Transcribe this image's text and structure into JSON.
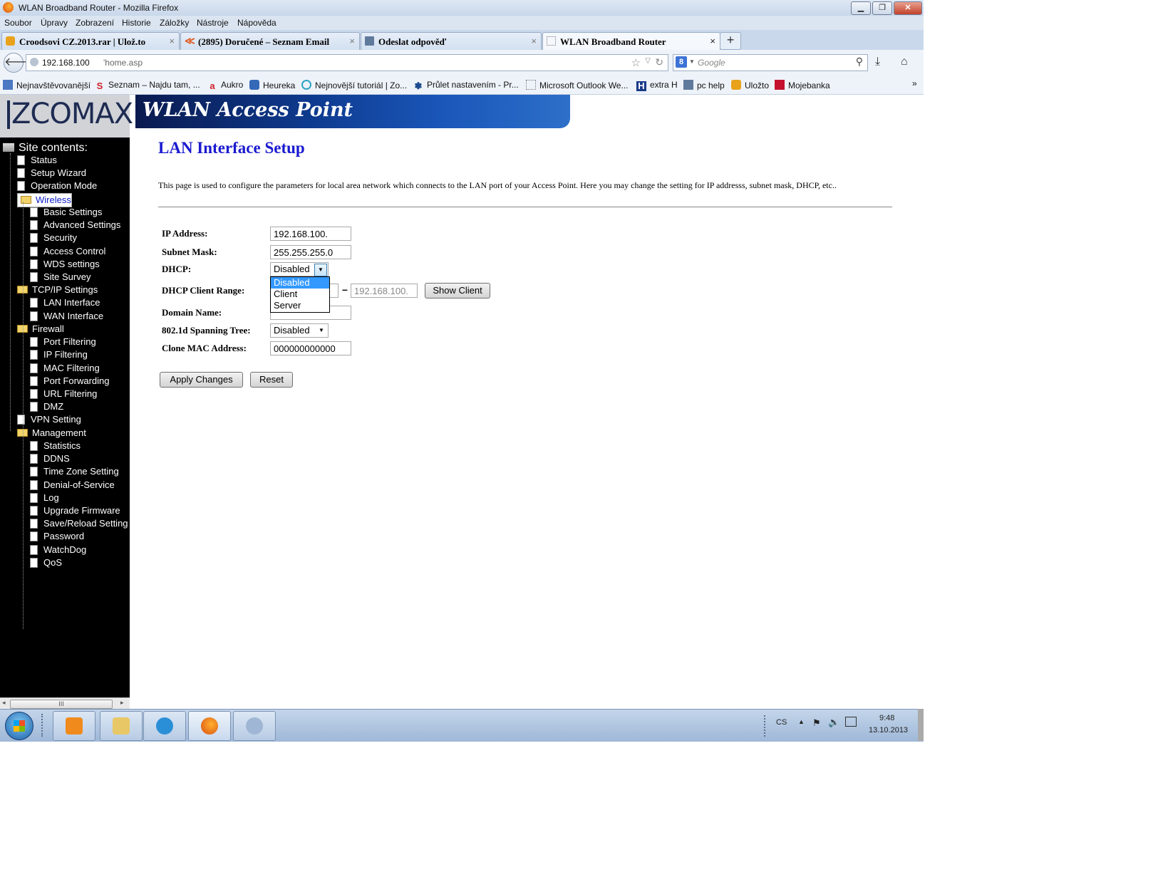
{
  "window": {
    "title": "WLAN Broadband Router - Mozilla Firefox",
    "buttons": {
      "minimize": "▁",
      "restore": "❐",
      "close": "✕"
    }
  },
  "menu": [
    "Soubor",
    "Úpravy",
    "Zobrazení",
    "Historie",
    "Záložky",
    "Nástroje",
    "Nápověda"
  ],
  "tabs": [
    {
      "label": "Croodsovi CZ.2013.rar | Ulož.to",
      "icon": "uloz-to-icon",
      "color": "#e9a21b"
    },
    {
      "label": "(2895) Doručené – Seznam Email",
      "icon": "seznam-email-icon",
      "color": "#e05a1e"
    },
    {
      "label": "Odeslat odpověď",
      "icon": "computer-icon",
      "color": "#607a9c"
    },
    {
      "label": "WLAN Broadband Router",
      "icon": "blank-page-icon",
      "color": "#ffffff"
    }
  ],
  "newtab_label": "+",
  "address": {
    "host": "192.168.100",
    "path": "'home.asp"
  },
  "search": {
    "engine": "8",
    "placeholder": "Google"
  },
  "bookmarks": [
    {
      "label": "Nejnavštěvovanější",
      "icon": "most-visited-icon",
      "glyph": "",
      "color": "#4a78c2"
    },
    {
      "label": "Seznam – Najdu tam, ...",
      "icon": "seznam-icon",
      "glyph": "S",
      "color": "#d0202a"
    },
    {
      "label": "Aukro",
      "icon": "aukro-icon",
      "glyph": "a",
      "color": "#d0202a"
    },
    {
      "label": "Heureka",
      "icon": "heureka-icon",
      "glyph": "",
      "color": "#3569b8"
    },
    {
      "label": "Nejnovější tutoriál | Zo...",
      "icon": "zoner-icon",
      "glyph": "",
      "color": "#2ea3c4"
    },
    {
      "label": "Průlet nastavením - Pr...",
      "icon": "gear-icon",
      "glyph": "",
      "color": "#1c4a8f"
    },
    {
      "label": "Microsoft Outlook We...",
      "icon": "blank-page-icon",
      "glyph": "",
      "color": "#ffffff"
    },
    {
      "label": "extra H",
      "icon": "extra-h-icon",
      "glyph": "H",
      "color": "#1a3a8a"
    },
    {
      "label": "pc help",
      "icon": "computer-icon",
      "glyph": "",
      "color": "#607a9c"
    },
    {
      "label": "Uložto",
      "icon": "uloz-to-icon",
      "glyph": "",
      "color": "#e9a21b"
    },
    {
      "label": "Mojebanka",
      "icon": "mojebanka-icon",
      "glyph": "",
      "color": "#c4122e"
    }
  ],
  "router": {
    "logo": "ZCOMAX",
    "banner": "WLAN Access Point",
    "sidebar_title": "Site contents:",
    "nav": [
      {
        "label": "Status",
        "level": 1,
        "type": "doc"
      },
      {
        "label": "Setup Wizard",
        "level": 1,
        "type": "doc"
      },
      {
        "label": "Operation Mode",
        "level": 1,
        "type": "doc"
      },
      {
        "label": "Wireless",
        "level": 1,
        "type": "folder",
        "selected": true
      },
      {
        "label": "Basic Settings",
        "level": 2,
        "type": "doc"
      },
      {
        "label": "Advanced Settings",
        "level": 2,
        "type": "doc"
      },
      {
        "label": "Security",
        "level": 2,
        "type": "doc"
      },
      {
        "label": "Access Control",
        "level": 2,
        "type": "doc"
      },
      {
        "label": "WDS settings",
        "level": 2,
        "type": "doc"
      },
      {
        "label": "Site Survey",
        "level": 2,
        "type": "doc"
      },
      {
        "label": "TCP/IP Settings",
        "level": 1,
        "type": "folder"
      },
      {
        "label": "LAN Interface",
        "level": 2,
        "type": "doc"
      },
      {
        "label": "WAN Interface",
        "level": 2,
        "type": "doc"
      },
      {
        "label": "Firewall",
        "level": 1,
        "type": "folder"
      },
      {
        "label": "Port Filtering",
        "level": 2,
        "type": "doc"
      },
      {
        "label": "IP Filtering",
        "level": 2,
        "type": "doc"
      },
      {
        "label": "MAC Filtering",
        "level": 2,
        "type": "doc"
      },
      {
        "label": "Port Forwarding",
        "level": 2,
        "type": "doc"
      },
      {
        "label": "URL Filtering",
        "level": 2,
        "type": "doc"
      },
      {
        "label": "DMZ",
        "level": 2,
        "type": "doc"
      },
      {
        "label": "VPN Setting",
        "level": 1,
        "type": "doc"
      },
      {
        "label": "Management",
        "level": 1,
        "type": "folder"
      },
      {
        "label": "Statistics",
        "level": 2,
        "type": "doc"
      },
      {
        "label": "DDNS",
        "level": 2,
        "type": "doc"
      },
      {
        "label": "Time Zone Setting",
        "level": 2,
        "type": "doc"
      },
      {
        "label": "Denial-of-Service",
        "level": 2,
        "type": "doc"
      },
      {
        "label": "Log",
        "level": 2,
        "type": "doc"
      },
      {
        "label": "Upgrade Firmware",
        "level": 2,
        "type": "doc"
      },
      {
        "label": "Save/Reload Setting",
        "level": 2,
        "type": "doc"
      },
      {
        "label": "Password",
        "level": 2,
        "type": "doc"
      },
      {
        "label": "WatchDog",
        "level": 2,
        "type": "doc"
      },
      {
        "label": "QoS",
        "level": 2,
        "type": "doc"
      }
    ],
    "sidebar_scroll_thumb": "III",
    "page": {
      "title": "LAN Interface Setup",
      "description": "This page is used to configure the parameters for local area network which connects to the LAN port of your Access Point. Here you may change the setting for IP addresss, subnet mask, DHCP, etc..",
      "ip_label": "IP Address:",
      "ip_value": "192.168.100.",
      "mask_label": "Subnet Mask:",
      "mask_value": "255.255.255.0",
      "dhcp_label": "DHCP:",
      "dhcp_value": "Disabled",
      "dhcp_options": [
        "Disabled",
        "Client",
        "Server"
      ],
      "range_label": "DHCP Client Range:",
      "range_dash": "–",
      "range_end": "192.168.100.",
      "show_client": "Show Client",
      "domain_label": "Domain Name:",
      "stp_label": "802.1d Spanning Tree:",
      "stp_value": "Disabled",
      "mac_label": "Clone MAC Address:",
      "mac_value": "000000000000",
      "apply": "Apply Changes",
      "reset": "Reset"
    }
  },
  "taskbar": {
    "apps": [
      {
        "name": "media-player-icon",
        "color": "#f08a1c"
      },
      {
        "name": "explorer-icon",
        "color": "#e8c766"
      },
      {
        "name": "internet-explorer-icon",
        "color": "#2b8fd8"
      },
      {
        "name": "firefox-icon",
        "color": "#e0631a"
      },
      {
        "name": "paint-icon",
        "color": "#9fb6d4"
      }
    ],
    "lang": "CS",
    "time": "9:48",
    "date": "13.10.2013"
  }
}
